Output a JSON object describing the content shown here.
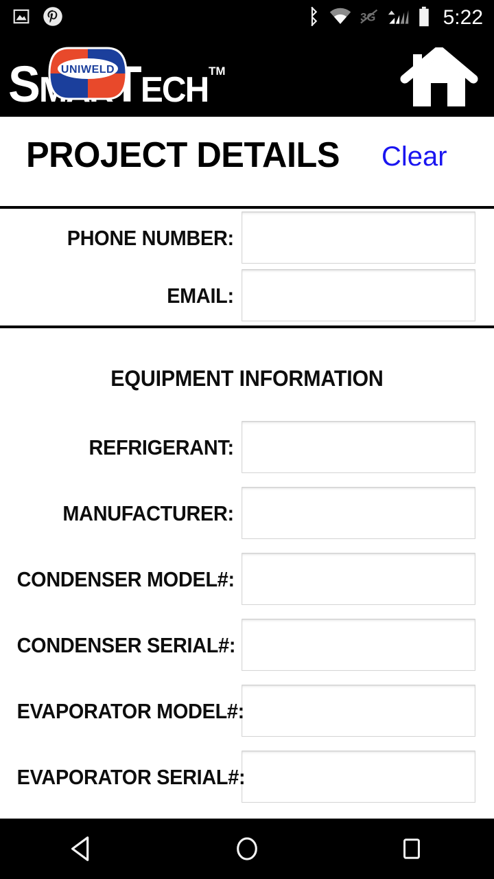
{
  "status_bar": {
    "time": "5:22",
    "left_icons": [
      "screenshot-icon",
      "pinterest-icon"
    ],
    "right_icons": [
      "bluetooth-icon",
      "wifi-icon",
      "mobile-data-off-icon",
      "cell-signal-icon",
      "battery-icon"
    ]
  },
  "app_bar": {
    "logo": {
      "part1": "S",
      "part2": "MAR",
      "part3": "T",
      "part4": "ECH",
      "trademark": "TM",
      "badge_text": "UNIWELD",
      "badge_red": "#e8492b",
      "badge_blue": "#1b3f9c"
    },
    "home_icon": "home-icon"
  },
  "header": {
    "title": "PROJECT DETAILS",
    "clear_label": "Clear",
    "clear_color": "#1a15f0"
  },
  "contact_section": {
    "fields": [
      {
        "label": "PHONE NUMBER:",
        "value": "",
        "placeholder": ""
      },
      {
        "label": "EMAIL:",
        "value": "",
        "placeholder": ""
      }
    ]
  },
  "equipment_section": {
    "heading": "EQUIPMENT INFORMATION",
    "fields": [
      {
        "label": "REFRIGERANT:",
        "value": "",
        "placeholder": ""
      },
      {
        "label": "MANUFACTURER:",
        "value": "",
        "placeholder": ""
      },
      {
        "label": "CONDENSER MODEL#:",
        "value": "",
        "placeholder": ""
      },
      {
        "label": "CONDENSER SERIAL#:",
        "value": "",
        "placeholder": ""
      },
      {
        "label": "EVAPORATOR MODEL#:",
        "value": "",
        "placeholder": ""
      },
      {
        "label": "EVAPORATOR SERIAL#:",
        "value": "",
        "placeholder": ""
      }
    ]
  },
  "nav_bar": {
    "buttons": [
      {
        "name": "back-button",
        "icon": "triangle-back-icon"
      },
      {
        "name": "home-button",
        "icon": "circle-home-icon"
      },
      {
        "name": "recents-button",
        "icon": "square-recents-icon"
      }
    ]
  }
}
